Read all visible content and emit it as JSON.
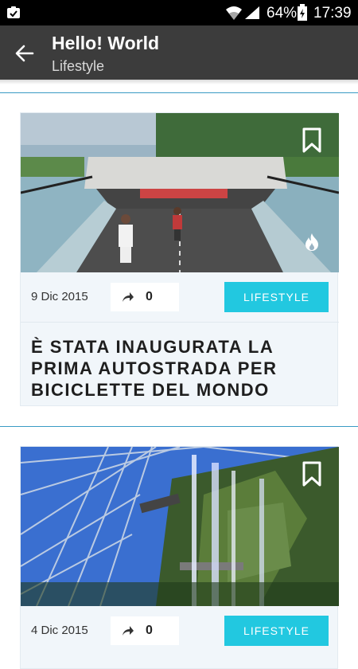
{
  "status_bar": {
    "battery_percent": "64%",
    "time": "17:39",
    "icons": [
      "notification-icon",
      "wifi-icon",
      "signal-icon",
      "battery-icon"
    ]
  },
  "toolbar": {
    "title": "Hello! World",
    "subtitle": "Lifestyle",
    "back_icon": "arrow-left-icon"
  },
  "articles": [
    {
      "date": "9 Dic 2015",
      "shares": "0",
      "category": "LIFESTYLE",
      "title": "È stata inaugurata la prima autostrada per biciclette del mondo",
      "image": "bicycle-highway-tunnel",
      "icons": [
        "bookmark-icon",
        "flame-icon",
        "share-icon"
      ]
    },
    {
      "date": "4 Dic 2015",
      "shares": "0",
      "category": "LIFESTYLE",
      "title": "",
      "image": "greenhouse-waterfall",
      "icons": [
        "bookmark-icon",
        "share-icon"
      ]
    }
  ],
  "colors": {
    "toolbar": "#3c3c3c",
    "accent": "#22c8e0",
    "divider": "#3a9bc4",
    "card_bg": "#f1f6fa"
  }
}
